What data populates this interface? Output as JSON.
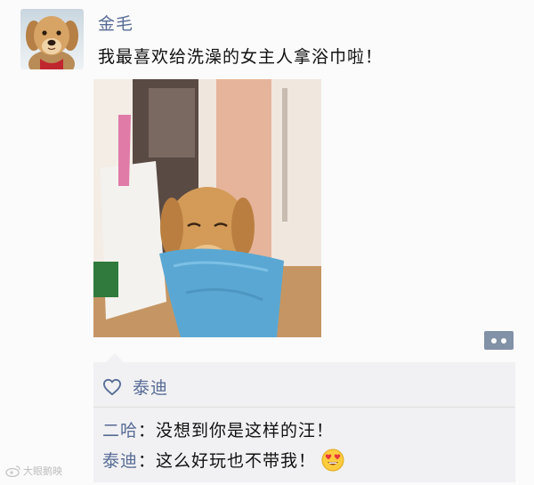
{
  "post": {
    "username": "金毛",
    "text": "我最喜欢给洗澡的女主人拿浴巾啦！"
  },
  "icons": {
    "avatar": "golden-retriever-avatar",
    "more": "comment-options-icon",
    "like": "heart-outline-icon",
    "emoji": "heart-eyes-emoji-icon",
    "watermark": "weibo-logo-icon"
  },
  "likes": {
    "names": "泰迪"
  },
  "comments": [
    {
      "author": "二哈",
      "separator": "：",
      "text": "没想到你是这样的汪！"
    },
    {
      "author": "泰迪",
      "separator": "：",
      "text": "这么好玩也不带我！"
    }
  ],
  "watermark": {
    "text": "大眼鹅映"
  },
  "colors": {
    "link_blue": "#576b95",
    "comment_bg": "#f1f1f3",
    "more_button": "#8191a6"
  }
}
